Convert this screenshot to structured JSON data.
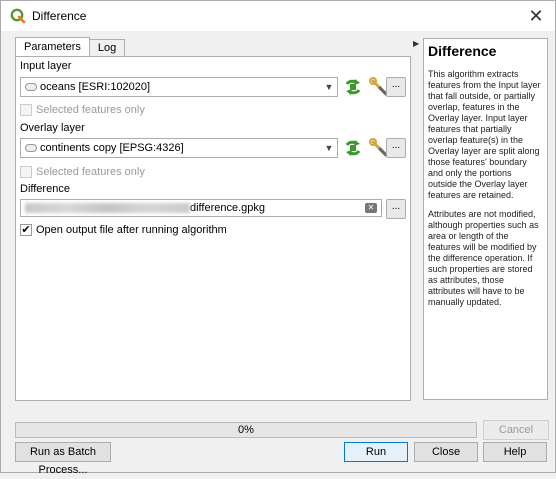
{
  "window": {
    "title": "Difference",
    "close_glyph": "✕"
  },
  "tabs": [
    "Parameters",
    "Log"
  ],
  "params": {
    "input_layer": {
      "label": "Input layer",
      "value": "oceans [ESRI:102020]",
      "selected_only": "Selected features only"
    },
    "overlay_layer": {
      "label": "Overlay layer",
      "value": "continents copy [EPSG:4326]",
      "selected_only": "Selected features only"
    },
    "output": {
      "label": "Difference",
      "value": "difference.gpkg",
      "open_after": "Open output file after running algorithm",
      "open_after_checked": true
    },
    "ellipsis": "...",
    "check_glyph": "✔",
    "chevron": "▼"
  },
  "help": {
    "title": "Difference",
    "p1": "This algorithm extracts features from the Input layer that fall outside, or partially overlap, features in the Overlay layer. Input layer features that partially overlap feature(s) in the Overlay layer are split along those features' boundary and only the portions outside the Overlay layer features are retained.",
    "p2": "Attributes are not modified, although properties such as area or length of the features will be modified by the difference operation. If such properties are stored as attributes, those attributes will have to be manually updated."
  },
  "progress": {
    "text": "0%",
    "value": 0
  },
  "buttons": {
    "cancel": "Cancel",
    "batch": "Run as Batch Process...",
    "run": "Run",
    "close": "Close",
    "help": "Help"
  },
  "icons": {
    "iterate": "iterate-icon",
    "settings": "wrench-icon",
    "collapse": "collapse-arrow-icon"
  },
  "colors": {
    "iterate_green": "#3a9a2a",
    "wrench_gold": "#d6a43a",
    "accent": "#0078d7"
  }
}
